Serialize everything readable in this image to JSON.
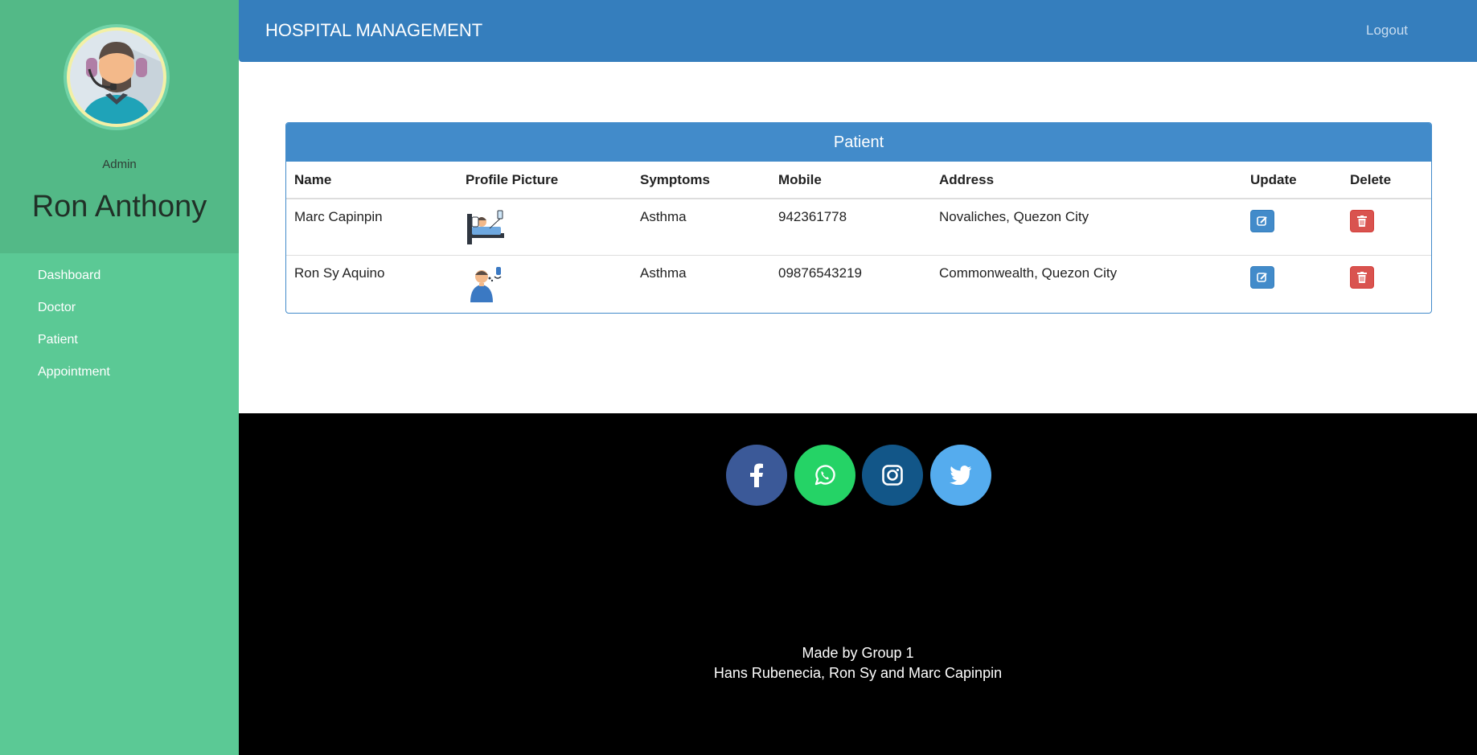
{
  "sidebar": {
    "role": "Admin",
    "user_name": "Ron Anthony",
    "avatar_icon": "admin-avatar",
    "items": [
      {
        "label": "Dashboard"
      },
      {
        "label": "Doctor"
      },
      {
        "label": "Patient"
      },
      {
        "label": "Appointment"
      }
    ]
  },
  "header": {
    "title": "HOSPITAL MANAGEMENT",
    "logout_label": "Logout"
  },
  "patient_panel": {
    "title": "Patient",
    "columns": [
      "Name",
      "Profile Picture",
      "Symptoms",
      "Mobile",
      "Address",
      "Update",
      "Delete"
    ],
    "rows": [
      {
        "name": "Marc Capinpin",
        "picture_icon": "patient-in-bed-icon",
        "symptoms": "Asthma",
        "mobile": "942361778",
        "address": "Novaliches, Quezon City"
      },
      {
        "name": "Ron Sy Aquino",
        "picture_icon": "patient-coughing-icon",
        "symptoms": "Asthma",
        "mobile": "09876543219",
        "address": "Commonwealth, Quezon City"
      }
    ]
  },
  "footer": {
    "social": [
      {
        "icon": "facebook-icon",
        "color": "#3b5998"
      },
      {
        "icon": "whatsapp-icon",
        "color": "#25d366"
      },
      {
        "icon": "instagram-icon",
        "color": "#125688"
      },
      {
        "icon": "twitter-icon",
        "color": "#55acee"
      }
    ],
    "credit_line1": "Made by Group 1",
    "credit_line2": "Hans Rubenecia, Ron Sy and Marc Capinpin"
  },
  "colors": {
    "sidebar": "#5bc995",
    "sidebar_profile": "#53b987",
    "primary": "#428bca",
    "danger": "#d9534f",
    "footer": "#000000"
  }
}
